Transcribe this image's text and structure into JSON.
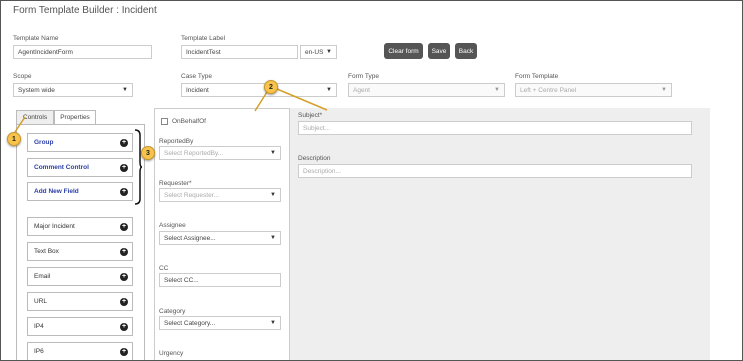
{
  "header": {
    "title": "Form Template Builder : Incident"
  },
  "fields": {
    "template_name": {
      "label": "Template Name",
      "value": "AgentIncidentForm"
    },
    "template_label": {
      "label": "Template Label",
      "value": "IncidentTest"
    },
    "language": {
      "value": "en-US"
    },
    "scope": {
      "label": "Scope",
      "value": "System wide"
    },
    "case_type": {
      "label": "Case Type",
      "value": "Incident"
    },
    "form_type": {
      "label": "Form Type",
      "value": "Agent"
    },
    "form_template": {
      "label": "Form Template",
      "value": "Left + Centre Panel"
    }
  },
  "buttons": {
    "clear": "Clear form",
    "save": "Save",
    "back": "Back"
  },
  "tabs": {
    "controls": "Controls",
    "properties": "Properties"
  },
  "controls": {
    "special": [
      "Group",
      "Comment Control",
      "Add New Field"
    ],
    "fields": [
      "Major Incident",
      "Text Box",
      "Email",
      "URL",
      "IP4",
      "IP6"
    ]
  },
  "center_panel": {
    "on_behalf_of": "OnBehalfOf",
    "reported_by": {
      "label": "ReportedBy",
      "placeholder": "Select ReportedBy..."
    },
    "requester": {
      "label": "Requester*",
      "placeholder": "Select Requester..."
    },
    "assignee": {
      "label": "Assignee",
      "value": "Select Assignee..."
    },
    "cc": {
      "label": "CC",
      "value": "Select CC..."
    },
    "category": {
      "label": "Category",
      "value": "Select Category..."
    },
    "urgency": {
      "label": "Urgency"
    }
  },
  "right_panel": {
    "subject": {
      "label": "Subject*",
      "placeholder": "Subject..."
    },
    "description": {
      "label": "Description",
      "placeholder": "Description..."
    }
  },
  "callouts": [
    "1",
    "2",
    "3"
  ],
  "icons": {
    "dropdown": "caret-down-icon",
    "add": "plus-circle-icon"
  },
  "colors": {
    "button": "#555555",
    "callout": "#f7c34a",
    "link_blue": "#2a3fa6"
  }
}
